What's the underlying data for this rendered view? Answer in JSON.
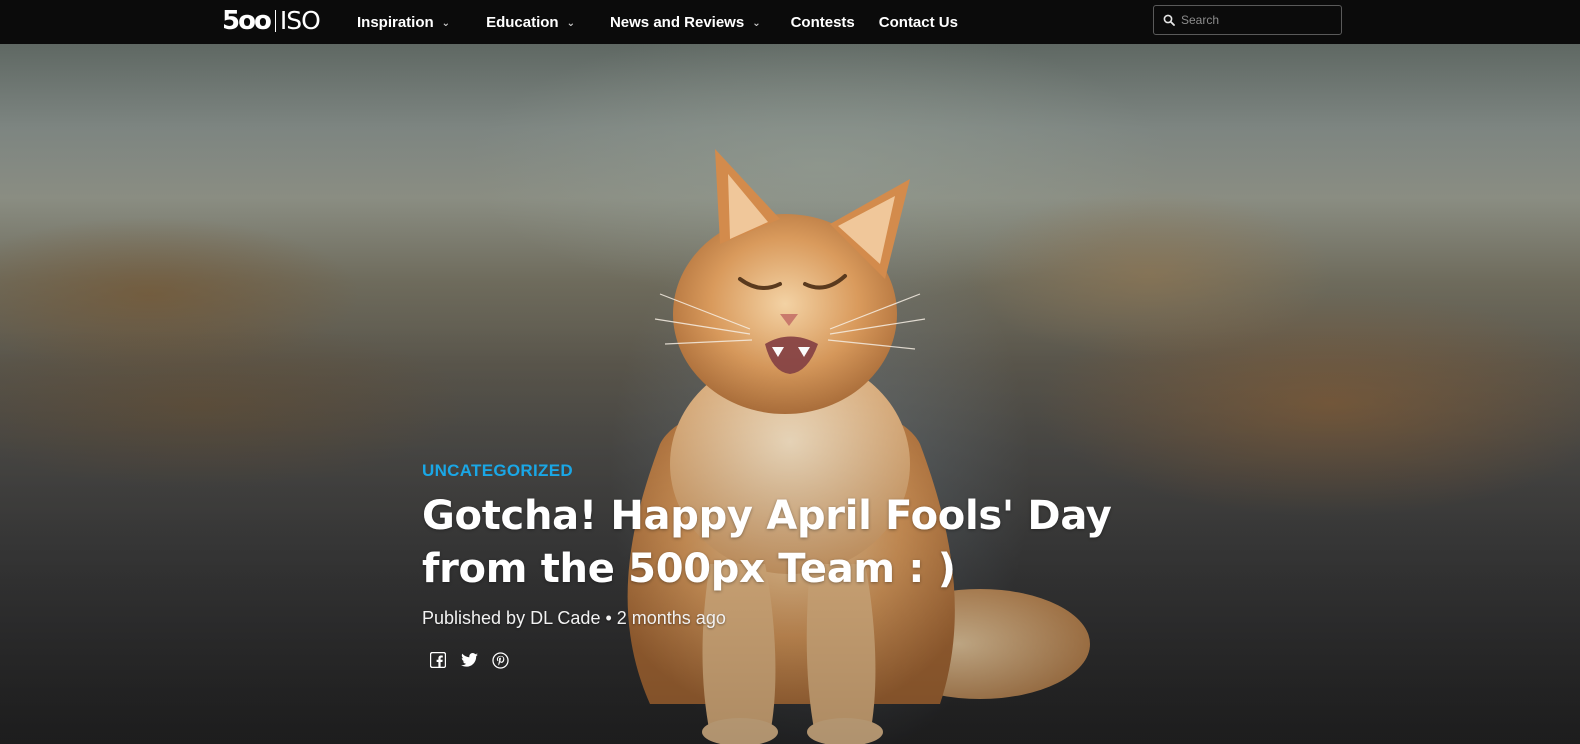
{
  "header": {
    "logo": {
      "mark": "5oo",
      "text": "ISO"
    },
    "nav": [
      {
        "label": "Inspiration",
        "has_dropdown": true
      },
      {
        "label": "Education",
        "has_dropdown": true
      },
      {
        "label": "News and Reviews",
        "has_dropdown": true
      },
      {
        "label": "Contests",
        "has_dropdown": false
      },
      {
        "label": "Contact Us",
        "has_dropdown": false
      }
    ],
    "search": {
      "placeholder": "Search",
      "icon": "search-icon"
    }
  },
  "hero": {
    "image": "laughing-orange-cat-on-road"
  },
  "article": {
    "category": "UNCATEGORIZED",
    "title_line1": "Gotcha! Happy April Fools' Day",
    "title_line2": "from the 500px Team : )",
    "byline_prefix": "Published by ",
    "author": "DL Cade",
    "byline_separator": " • ",
    "date": "2 months ago",
    "share": [
      "facebook-icon",
      "twitter-icon",
      "pinterest-icon"
    ]
  },
  "colors": {
    "nav_bg": "#0b0b0b",
    "category_accent": "#1aa7e6",
    "text": "#ffffff"
  }
}
